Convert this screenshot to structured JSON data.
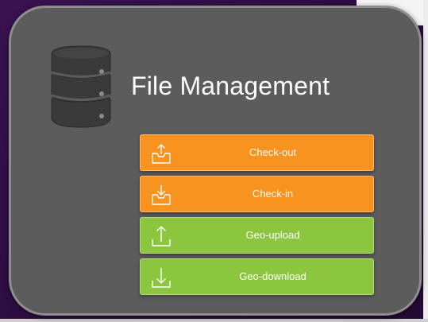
{
  "title": "File Management",
  "colors": {
    "background": "#2b0c3f",
    "panel": "#5c5c5c",
    "panel_border": "#8e8e8e",
    "orange": "#f7931e",
    "green": "#8cc63f"
  },
  "buttons": [
    {
      "label": "Check-out",
      "icon": "tray-upload-icon",
      "color": "#f7931e"
    },
    {
      "label": "Check-in",
      "icon": "tray-download-icon",
      "color": "#f7931e"
    },
    {
      "label": "Geo-upload",
      "icon": "upload-arrow-icon",
      "color": "#8cc63f"
    },
    {
      "label": "Geo-download",
      "icon": "download-arrow-icon",
      "color": "#8cc63f"
    }
  ],
  "header_icon": "database-icon"
}
